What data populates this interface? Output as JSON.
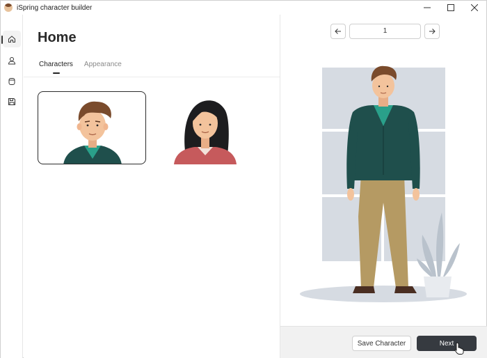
{
  "window": {
    "title": "iSpring character builder",
    "controls": [
      "minimize-icon",
      "maximize-icon",
      "close-icon"
    ]
  },
  "rail": {
    "items": [
      {
        "name": "home",
        "icon": "home-icon",
        "active": true
      },
      {
        "name": "characters",
        "icon": "person-icon",
        "active": false
      },
      {
        "name": "assets",
        "icon": "cylinder-icon",
        "active": false
      },
      {
        "name": "save",
        "icon": "save-icon",
        "active": false
      }
    ]
  },
  "main": {
    "title": "Home",
    "tabs": [
      {
        "label": "Characters",
        "active": true
      },
      {
        "label": "Appearance",
        "active": false
      }
    ],
    "characters": [
      {
        "name": "male-character",
        "selected": true
      },
      {
        "name": "female-character",
        "selected": false
      }
    ]
  },
  "preview": {
    "page": "1",
    "prev_icon": "arrow-left-icon",
    "next_icon": "arrow-right-icon"
  },
  "footer": {
    "save_label": "Save Character",
    "next_label": "Next"
  },
  "colors": {
    "accent_dark": "#363a40",
    "cardigan": "#1f4f4c",
    "shirt": "#2aa08a",
    "pants": "#b59a63",
    "hair": "#7a4b2c",
    "skin": "#f3c39c",
    "window_panels": "#d6dbe2"
  }
}
